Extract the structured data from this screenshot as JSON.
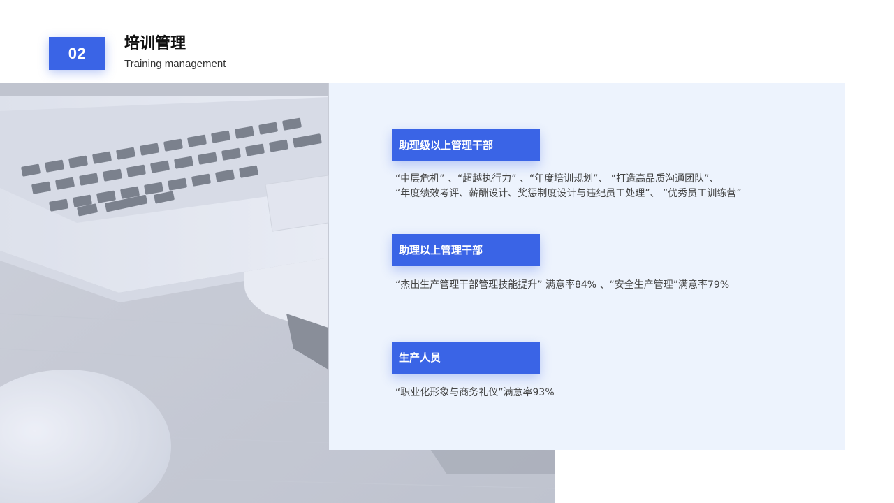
{
  "header": {
    "number": "02",
    "title_cn": "培训管理",
    "title_en": "Training management"
  },
  "sections": [
    {
      "heading": "助理级以上管理干部",
      "lines": [
        "“中层危机” 、“超越执行力” 、“年度培训规划”、 “打造高品质沟通团队”、",
        "“年度绩效考评、薪酬设计、奖惩制度设计与违纪员工处理”、 “优秀员工训练营”"
      ]
    },
    {
      "heading": "助理以上管理干部",
      "lines": [
        "“杰出生产管理干部管理技能提升” 满意率84% 、“安全生产管理”满意率79%"
      ]
    },
    {
      "heading": "生产人员",
      "lines": [
        "“职业化形象与商务礼仪”满意率93%"
      ]
    }
  ],
  "colors": {
    "accent": "#3a64e6",
    "panel_bg": "#edf3fd"
  }
}
